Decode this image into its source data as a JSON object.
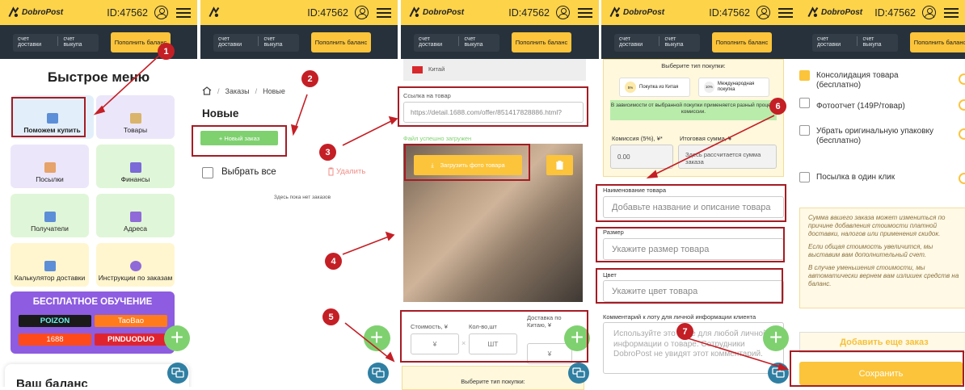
{
  "header": {
    "logo_text": "DobroPost",
    "user_id": "ID:47562"
  },
  "account_bar": {
    "delivery_account": "счет доставки",
    "purchase_account": "счет выкупа",
    "topup_button": "Пополнить баланс"
  },
  "steps": [
    "1",
    "2",
    "3",
    "4",
    "5",
    "6",
    "7"
  ],
  "panel1": {
    "title": "Быстрое меню",
    "tiles": [
      "Поможем купить",
      "Товары",
      "Посылки",
      "Финансы",
      "Получатели",
      "Адреса",
      "Калькулятор доставки",
      "Инструкции по заказам"
    ],
    "free_training": "БЕСПЛАТНОЕ ОБУЧЕНИЕ",
    "platforms": [
      "POIZON",
      "TaoBao",
      "1688",
      "PINDUODUO"
    ],
    "balance_title": "Ваш баланс"
  },
  "panel2": {
    "breadcrumb": [
      "Заказы",
      "Новые"
    ],
    "title": "Новые",
    "new_order_button": "+ Новый заказ",
    "select_all": "Выбрать все",
    "delete": "Удалить",
    "empty_text": "Здесь пока нет заказов"
  },
  "panel3": {
    "country": "Китай",
    "link_label": "Ссылка на товар",
    "link_value": "https://detail.1688.com/offer/851417828886.html?",
    "upload_success": "Файл успешно загружен",
    "upload_button": "Загрузить фото товара",
    "price_label": "Стоимость, ¥",
    "price_value": "¥",
    "qty_label": "Кол-во,шт",
    "qty_value": "ШТ",
    "delivery_label": "Доставка по Китаю, ¥",
    "delivery_value": "¥",
    "multiply": "×",
    "purchase_type_label": "Выберите тип покупки:"
  },
  "panel4": {
    "purchase_type_label": "Выберите тип покупки:",
    "option1": {
      "percent": "5%",
      "label": "Покупка из Китая"
    },
    "option2": {
      "percent": "10%",
      "label": "Международная покупка"
    },
    "notice": "В зависимости от выбранной покупки применяется разный процент комиссии.",
    "commission_label": "Комиссия (5%), ¥*",
    "commission_value": "0.00",
    "total_label": "Итоговая сумма, ¥",
    "total_value": "Здесь рассчитается сумма заказа",
    "name_label": "Наименование товара",
    "name_placeholder": "Добавьте название и описание товара",
    "size_label": "Размер",
    "size_placeholder": "Укажите размер товара",
    "color_label": "Цвет",
    "color_placeholder": "Укажите цвет товара",
    "comment_label": "Комментарий к лоту для личной информации клиента",
    "comment_placeholder": "Используйте это поле для любой личной информации о товаре. Сотрудники DobroPost не увидят этот комментарий."
  },
  "panel5": {
    "options": [
      {
        "label": "Консолидация товара (бесплатно)",
        "checked": true
      },
      {
        "label": "Фотоотчет (149Р/товар)",
        "checked": false
      },
      {
        "label": "Убрать оригинальную упаковку (бесплатно)",
        "checked": false
      },
      {
        "label": "Посылка в один клик",
        "checked": false
      }
    ],
    "warning": [
      "Сумма вашего заказа может измениться по причине добавления стоимости платной доставки, налогов или применения скидок.",
      "Если общая стоимость увеличится, мы выставим вам дополнительный счет.",
      "В случае уменьшения стоимости, мы автоматически вернем вам излишек средств на баланс."
    ],
    "add_more": "Добавить еще заказ",
    "save": "Сохранить"
  },
  "colors": {
    "accent_yellow": "#fbc43a",
    "header_yellow": "#fdd34a",
    "dark_bar": "#26313c",
    "green": "#7fd170",
    "annotation_red": "#c41f25",
    "purple": "#8d5ce0"
  }
}
